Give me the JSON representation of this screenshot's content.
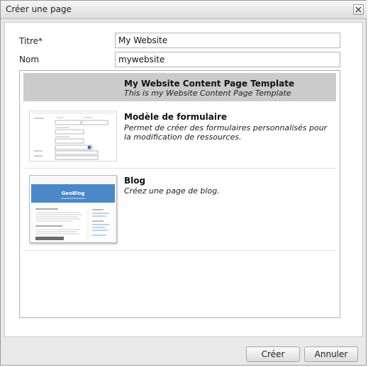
{
  "dialog": {
    "title": "Créer une page",
    "close_icon": "close-icon"
  },
  "form": {
    "title_label": "Titre*",
    "title_value": "My Website",
    "name_label": "Nom",
    "name_value": "mywebsite"
  },
  "templates": [
    {
      "name": "My Website Content Page Template",
      "description": "This is my Website Content Page Template",
      "selected": true
    },
    {
      "name": "Modèle de formulaire",
      "description": "Permet de créer des formulaires personnalisés pour la modification de ressources.",
      "thumbnail": "form-template-thumbnail"
    },
    {
      "name": "Blog",
      "description": "Créez une page de blog.",
      "thumbnail": "blog-template-thumbnail",
      "thumbnail_banner_text": "GeoBlog"
    }
  ],
  "footer": {
    "create_label": "Créer",
    "cancel_label": "Annuler"
  },
  "colors": {
    "selected_row": "#cbcbcb",
    "blog_banner": "#4a88c7"
  }
}
